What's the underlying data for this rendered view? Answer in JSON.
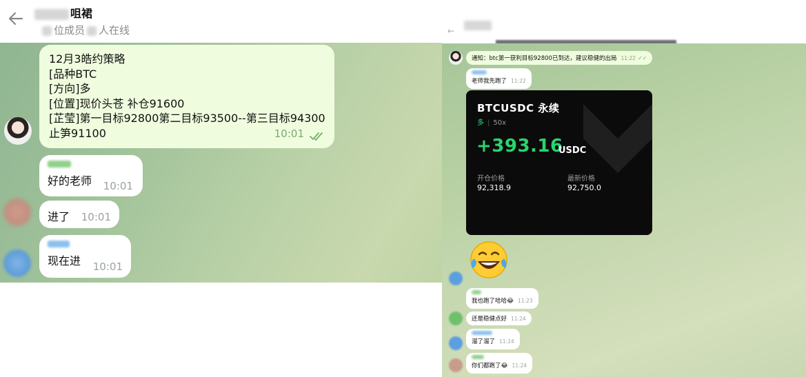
{
  "left_panel": {
    "header": {
      "title_suffix": "咀裙",
      "subtitle_part1": "位成员",
      "subtitle_part2": "人在线"
    },
    "messages": [
      {
        "lines": [
          "12月3皓约策略",
          " [品种BTC",
          " [方向]多",
          " [位置]现价头苍 补仓91600",
          " [芷莹]第一目标92800第二目标93500--第三目标94300",
          "止笋91100"
        ],
        "time": "10:01"
      },
      {
        "text": "好的老师",
        "time": "10:01"
      },
      {
        "text": "进了",
        "time": "10:01"
      },
      {
        "text": "现在进",
        "time": "10:01"
      }
    ]
  },
  "right_panel": {
    "messages": [
      {
        "text": "通知：btc第一获利目标92800已到达，建议稳健的出局",
        "time": "11:22"
      },
      {
        "text": "老师我先跑了",
        "time": "11:22"
      },
      {
        "text": "我也跑了哈哈😂",
        "time": "11:23"
      },
      {
        "text": "还是稳健点好",
        "time": "11:24"
      },
      {
        "text": "溜了溜了",
        "time": "11:24"
      },
      {
        "text": "你们都跑了😂",
        "time": "11:24"
      }
    ],
    "card": {
      "title": "BTCUSDC 永续",
      "direction": "多",
      "leverage": "50x",
      "pnl": "+393.16",
      "currency": "USDC",
      "open_label": "开仓价格",
      "open_value": "92,318.9",
      "last_label": "最新价格",
      "last_value": "92,750.0"
    },
    "emoji": "laughing-tears-emoji"
  },
  "colors": {
    "incoming_bubble": "#ffffff",
    "outgoing_bubble": "#effdde",
    "profit_green": "#29d46e",
    "read_ticks": "#6fae6a"
  }
}
